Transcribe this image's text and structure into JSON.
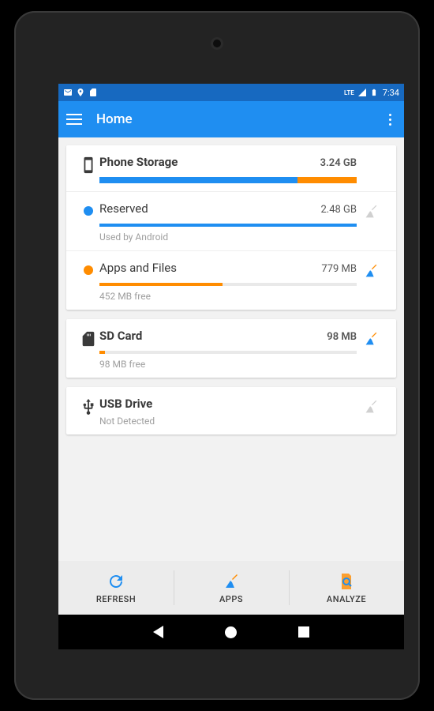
{
  "status": {
    "time": "7:34",
    "lte": "LTE"
  },
  "appbar": {
    "title": "Home"
  },
  "phone": {
    "title": "Phone Storage",
    "total": "3.24 GB",
    "seg_blue_pct": 77,
    "seg_orange_pct": 23,
    "reserved": {
      "label": "Reserved",
      "value": "2.48 GB",
      "sub": "Used by Android",
      "bar_pct": 100,
      "color": "#1f8ef1"
    },
    "apps": {
      "label": "Apps and Files",
      "value": "779 MB",
      "sub": "452 MB free",
      "bar_pct": 48,
      "color": "#ff8c00"
    }
  },
  "sd": {
    "title": "SD Card",
    "value": "98 MB",
    "sub": "98 MB free",
    "bar_pct": 2,
    "color": "#ff8c00"
  },
  "usb": {
    "title": "USB Drive",
    "sub": "Not Detected"
  },
  "actions": {
    "refresh": "REFRESH",
    "apps": "APPS",
    "analyze": "ANALYZE"
  },
  "colors": {
    "blue": "#1f8ef1",
    "orange": "#ff8c00",
    "grey": "#d0d0d0"
  }
}
